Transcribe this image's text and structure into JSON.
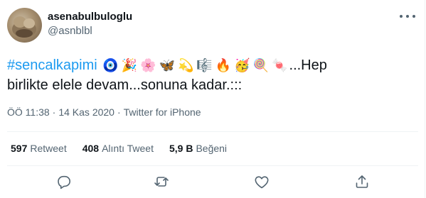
{
  "user": {
    "display_name": "asenabulbuloglu",
    "handle": "@asnblbl",
    "avatar_icon": "user-avatar-photo"
  },
  "tweet": {
    "hashtag": "#sencalkapimi",
    "emojis": [
      "🧿",
      "🎉",
      "🌸",
      "🦋",
      "💫",
      "🎼",
      "🔥",
      "🥳",
      "🍭",
      "🍬"
    ],
    "text_after_emojis": "...Hep",
    "text_line2": "birlikte elele devam...sonuna kadar.:::"
  },
  "meta": {
    "time": "ÖÖ 11:38",
    "separator1": "·",
    "date": "14 Kas 2020",
    "separator2": "·",
    "source": "Twitter for iPhone"
  },
  "stats": {
    "retweets_count": "597",
    "retweets_label": "Retweet",
    "quotes_count": "408",
    "quotes_label": "Alıntı Tweet",
    "likes_count": "5,9 B",
    "likes_label": "Beğeni"
  },
  "actions": {
    "reply_icon": "reply-icon",
    "retweet_icon": "retweet-icon",
    "like_icon": "heart-icon",
    "share_icon": "share-icon"
  },
  "colors": {
    "link": "#1d9bf0",
    "secondary_text": "#536471",
    "primary_text": "#0f1419",
    "divider": "#eff3f4"
  }
}
